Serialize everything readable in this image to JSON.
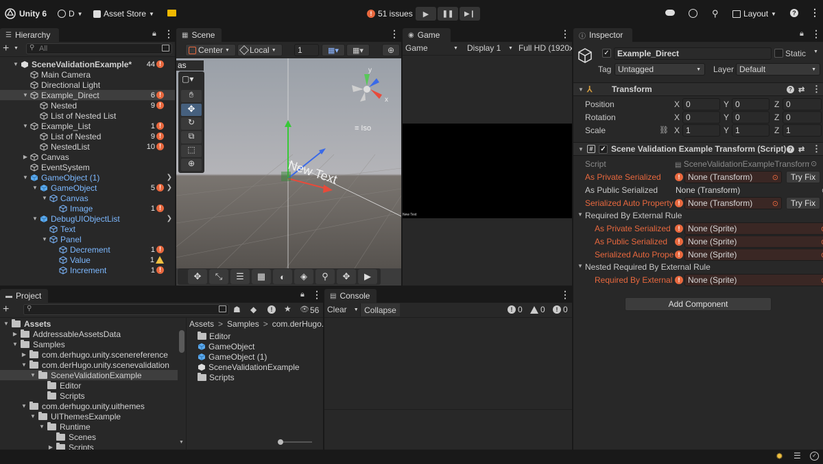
{
  "toolbar": {
    "app_name": "Unity 6",
    "account": "D",
    "asset_store": "Asset Store",
    "issues": "51 issues",
    "layout": "Layout"
  },
  "hierarchy": {
    "tab": "Hierarchy",
    "search_placeholder": "All",
    "rows": [
      {
        "label": "SceneValidationExample*",
        "count": "44",
        "level": 0,
        "arrow": "down",
        "kind": "scene",
        "icon": "err",
        "blue": false,
        "selected": false
      },
      {
        "label": "Main Camera",
        "count": "",
        "level": 1,
        "arrow": "",
        "kind": "cube",
        "icon": "",
        "blue": false,
        "selected": false
      },
      {
        "label": "Directional Light",
        "count": "",
        "level": 1,
        "arrow": "",
        "kind": "cube",
        "icon": "",
        "blue": false,
        "selected": false
      },
      {
        "label": "Example_Direct",
        "count": "6",
        "level": 1,
        "arrow": "down",
        "kind": "cube",
        "icon": "err",
        "blue": false,
        "selected": true
      },
      {
        "label": "Nested",
        "count": "9",
        "level": 2,
        "arrow": "",
        "kind": "cube",
        "icon": "err",
        "blue": false,
        "selected": false
      },
      {
        "label": "List of Nested List",
        "count": "",
        "level": 2,
        "arrow": "",
        "kind": "cube",
        "icon": "",
        "blue": false,
        "selected": false
      },
      {
        "label": "Example_List",
        "count": "1",
        "level": 1,
        "arrow": "down",
        "kind": "cube",
        "icon": "err",
        "blue": false,
        "selected": false
      },
      {
        "label": "List of Nested",
        "count": "9",
        "level": 2,
        "arrow": "",
        "kind": "cube",
        "icon": "err",
        "blue": false,
        "selected": false
      },
      {
        "label": "NestedList",
        "count": "10",
        "level": 2,
        "arrow": "",
        "kind": "cube",
        "icon": "err",
        "blue": false,
        "selected": false
      },
      {
        "label": "Canvas",
        "count": "",
        "level": 1,
        "arrow": "right",
        "kind": "cube",
        "icon": "",
        "blue": false,
        "selected": false
      },
      {
        "label": "EventSystem",
        "count": "",
        "level": 1,
        "arrow": "",
        "kind": "cube",
        "icon": "",
        "blue": false,
        "selected": false
      },
      {
        "label": "GameObject (1)",
        "count": "",
        "level": 1,
        "arrow": "down",
        "kind": "prefab",
        "icon": "",
        "blue": true,
        "selected": false,
        "chev": true
      },
      {
        "label": "GameObject",
        "count": "5",
        "level": 2,
        "arrow": "down",
        "kind": "prefab",
        "icon": "err",
        "blue": true,
        "selected": false,
        "chev": true
      },
      {
        "label": "Canvas",
        "count": "",
        "level": 3,
        "arrow": "down",
        "kind": "cube",
        "icon": "",
        "blue": true,
        "selected": false
      },
      {
        "label": "Image",
        "count": "1",
        "level": 4,
        "arrow": "",
        "kind": "cube",
        "icon": "err",
        "blue": true,
        "selected": false
      },
      {
        "label": "DebugUIObjectList",
        "count": "",
        "level": 2,
        "arrow": "down",
        "kind": "prefab",
        "icon": "",
        "blue": true,
        "selected": false,
        "chev": true
      },
      {
        "label": "Text",
        "count": "",
        "level": 3,
        "arrow": "",
        "kind": "cube",
        "icon": "",
        "blue": true,
        "selected": false
      },
      {
        "label": "Panel",
        "count": "",
        "level": 3,
        "arrow": "down",
        "kind": "cube",
        "icon": "",
        "blue": true,
        "selected": false
      },
      {
        "label": "Decrement",
        "count": "1",
        "level": 4,
        "arrow": "",
        "kind": "cube",
        "icon": "err",
        "blue": true,
        "selected": false
      },
      {
        "label": "Value",
        "count": "1",
        "level": 4,
        "arrow": "",
        "kind": "cube",
        "icon": "warn",
        "blue": true,
        "selected": false
      },
      {
        "label": "Increment",
        "count": "1",
        "level": 4,
        "arrow": "",
        "kind": "cube",
        "icon": "err",
        "blue": true,
        "selected": false
      }
    ]
  },
  "scene": {
    "tab": "Scene",
    "pivot": "Center",
    "space": "Local",
    "grid_value": "1",
    "overlay_label": "as",
    "iso_label": "Iso",
    "gizmo_y": "y",
    "gizmo_x": "x",
    "world_text": "New Text"
  },
  "game": {
    "tab": "Game",
    "mode": "Game",
    "display": "Display 1",
    "resolution": "Full HD (1920x",
    "small_text": "New Text"
  },
  "inspector": {
    "tab": "Inspector",
    "object_name": "Example_Direct",
    "static_label": "Static",
    "tag_label": "Tag",
    "tag_value": "Untagged",
    "layer_label": "Layer",
    "layer_value": "Default",
    "transform": {
      "title": "Transform",
      "position_label": "Position",
      "rotation_label": "Rotation",
      "scale_label": "Scale",
      "position": [
        "0",
        "0",
        "0"
      ],
      "rotation": [
        "0",
        "0",
        "0"
      ],
      "scale": [
        "1",
        "1",
        "1"
      ],
      "axis_x": "X",
      "axis_y": "Y",
      "axis_z": "Z"
    },
    "script_component": {
      "title": "Scene Validation Example Transform (Script)",
      "script_label": "Script",
      "script_value": "SceneValidationExampleTransform",
      "fields": [
        {
          "label": "As Private Serialized",
          "value": "None (Transform)",
          "error": true,
          "fix": "Try Fix",
          "indent": 0
        },
        {
          "label": "As Public Serialized",
          "value": "None (Transform)",
          "error": false,
          "fix": "",
          "indent": 0
        },
        {
          "label": "Serialized Auto Property",
          "value": "None (Transform)",
          "error": true,
          "fix": "Try Fix",
          "indent": 0
        }
      ],
      "group1_label": "Required By External Rule",
      "group1_fields": [
        {
          "label": "As Private Serialized",
          "value": "None (Sprite)"
        },
        {
          "label": "As Public Serialized",
          "value": "None (Sprite)"
        },
        {
          "label": "Serialized Auto Prope",
          "value": "None (Sprite)"
        }
      ],
      "group2_label": "Nested Required By External Rule",
      "group2_fields": [
        {
          "label": "Required By External",
          "value": "None (Sprite)"
        }
      ]
    },
    "add_component": "Add Component"
  },
  "project": {
    "tab": "Project",
    "hidden_count": "56",
    "tree": [
      {
        "label": "Assets",
        "level": 0,
        "arrow": "down",
        "bold": true,
        "selected": false
      },
      {
        "label": "AddressableAssetsData",
        "level": 1,
        "arrow": "right",
        "bold": false,
        "selected": false
      },
      {
        "label": "Samples",
        "level": 1,
        "arrow": "down",
        "bold": false,
        "selected": false
      },
      {
        "label": "com.derhugo.unity.scenereference",
        "level": 2,
        "arrow": "right",
        "bold": false,
        "selected": false
      },
      {
        "label": "com.derHugo.unity.scenevalidation",
        "level": 2,
        "arrow": "down",
        "bold": false,
        "selected": false
      },
      {
        "label": "SceneValidationExample",
        "level": 3,
        "arrow": "down",
        "bold": false,
        "selected": true
      },
      {
        "label": "Editor",
        "level": 4,
        "arrow": "",
        "bold": false,
        "selected": false
      },
      {
        "label": "Scripts",
        "level": 4,
        "arrow": "",
        "bold": false,
        "selected": false
      },
      {
        "label": "com.derhugo.unity.uithemes",
        "level": 2,
        "arrow": "down",
        "bold": false,
        "selected": false
      },
      {
        "label": "UIThemesExample",
        "level": 3,
        "arrow": "down",
        "bold": false,
        "selected": false
      },
      {
        "label": "Runtime",
        "level": 4,
        "arrow": "down",
        "bold": false,
        "selected": false
      },
      {
        "label": "Scenes",
        "level": 5,
        "arrow": "",
        "bold": false,
        "selected": false
      },
      {
        "label": "Scripts",
        "level": 5,
        "arrow": "right",
        "bold": false,
        "selected": false
      }
    ],
    "breadcrumb": [
      "Assets",
      "Samples",
      "com.derHugo.u"
    ],
    "files": [
      {
        "label": "Editor",
        "kind": "folder"
      },
      {
        "label": "GameObject",
        "kind": "prefab"
      },
      {
        "label": "GameObject (1)",
        "kind": "prefab"
      },
      {
        "label": "SceneValidationExample",
        "kind": "scene"
      },
      {
        "label": "Scripts",
        "kind": "folder"
      }
    ]
  },
  "console": {
    "tab": "Console",
    "clear": "Clear",
    "collapse": "Collapse",
    "errors": "0",
    "warnings": "0",
    "infos": "0"
  },
  "colors": {
    "error": "#e8683e",
    "warning": "#f0c040",
    "prefab_blue": "#7cb8ff",
    "selection": "#3e3e3e"
  }
}
